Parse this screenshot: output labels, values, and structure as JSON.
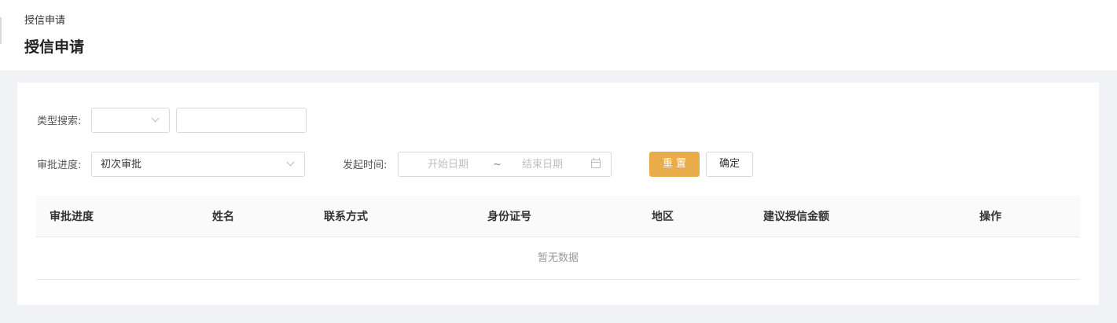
{
  "header": {
    "breadcrumb": "授信申请",
    "title": "授信申请"
  },
  "filters": {
    "type_search_label": "类型搜索:",
    "type_select_value": "",
    "type_keyword_value": "",
    "progress_label": "审批进度:",
    "progress_select_value": "初次审批",
    "time_label": "发起时间:",
    "start_placeholder": "开始日期",
    "range_separator": "~",
    "end_placeholder": "结束日期",
    "reset_label": "重置",
    "confirm_label": "确定"
  },
  "colors": {
    "accent": "#e9ac4b"
  },
  "table": {
    "columns": [
      "审批进度",
      "姓名",
      "联系方式",
      "身份证号",
      "地区",
      "建议授信金额",
      "操作"
    ],
    "rows": [],
    "empty_text": "暂无数据"
  }
}
